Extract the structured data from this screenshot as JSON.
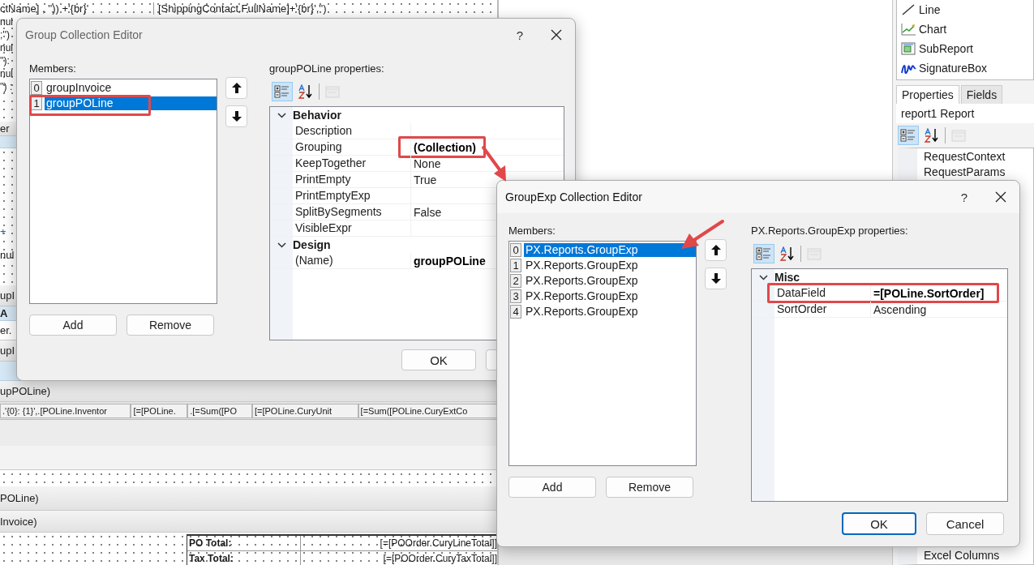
{
  "designer": {
    "top_texts": [
      "ctName] , '')) +'{br}'",
      "[ShippingContact.FullName]+'{br}','')"
    ],
    "left_fragments": [
      "nul",
      ";'')",
      "nul",
      "''):",
      "nul",
      "'') :"
    ],
    "bands": [
      {
        "kind": "label",
        "text": "er"
      },
      {
        "kind": "header"
      },
      {
        "kind": "dotted",
        "fragments": [
          "+",
          "nul"
        ]
      },
      {
        "kind": "label",
        "text": "upI"
      },
      {
        "kind": "header",
        "text": "A"
      },
      {
        "kind": "row",
        "text": "er."
      },
      {
        "kind": "label",
        "text": "upI"
      },
      {
        "kind": "header"
      },
      {
        "kind": "label",
        "text": "upPOLine)"
      },
      {
        "kind": "cells",
        "cells": [
          ".'{0}: {1}',.[POLine.Inventor",
          "[=[POLine.",
          ".[=Sum([PO",
          "[=[POLine.CuryUnit",
          "[=Sum([POLine.CuryExtCo"
        ]
      },
      {
        "kind": "blank"
      },
      {
        "kind": "blank"
      },
      {
        "kind": "dotted"
      },
      {
        "kind": "label",
        "text": "POLine)"
      },
      {
        "kind": "label",
        "text": "Invoice)"
      },
      {
        "kind": "totals",
        "rows": [
          {
            "label": "PO Total:",
            "value": "[=[POOrder.CuryLineTotal]]"
          },
          {
            "label": "Tax Total:",
            "value": "[=[POOrder.CuryTaxTotal]]"
          }
        ]
      }
    ]
  },
  "toolbox": {
    "items": [
      {
        "kind": "line",
        "label": "Line"
      },
      {
        "kind": "chart",
        "label": "Chart"
      },
      {
        "kind": "subreport",
        "label": "SubReport"
      },
      {
        "kind": "signature",
        "label": "SignatureBox"
      }
    ]
  },
  "properties_panel": {
    "tabs": [
      {
        "label": "Properties",
        "selected": true
      },
      {
        "label": "Fields",
        "selected": false
      }
    ],
    "object": "report1 Report",
    "toolbar": [
      {
        "kind": "categorized",
        "selected": true,
        "disabled": false
      },
      {
        "kind": "alphabetical",
        "selected": false,
        "disabled": false
      },
      {
        "kind": "pages",
        "selected": false,
        "disabled": true
      }
    ],
    "rows_top": [
      "RequestContext",
      "RequestParams"
    ],
    "rows_bottom": [
      "Excel Columns"
    ]
  },
  "dialogs": [
    {
      "title": "Group Collection Editor",
      "active": false,
      "help": "?",
      "members_label": "Members:",
      "members": [
        {
          "index": "0",
          "name": "groupInvoice",
          "selected": false,
          "highlighted": false
        },
        {
          "index": "1",
          "name": "groupPOLine",
          "selected": true,
          "highlighted": true
        }
      ],
      "buttons": [
        "Add",
        "Remove"
      ],
      "properties_label": "groupPOLine properties:",
      "toolbar": [
        {
          "kind": "categorized",
          "selected": true,
          "disabled": false
        },
        {
          "kind": "alphabetical",
          "selected": false,
          "disabled": false
        },
        {
          "kind": "pages",
          "selected": false,
          "disabled": true
        }
      ],
      "categories": [
        {
          "name": "Behavior",
          "expanded": true,
          "rows": [
            {
              "name": "Description"
            },
            {
              "name": "Grouping",
              "value": "(Collection)",
              "modified": true,
              "highlighted": true
            },
            {
              "name": "KeepTogether",
              "value": "None",
              "modified": false
            },
            {
              "name": "PrintEmpty",
              "value": "True",
              "modified": false
            },
            {
              "name": "PrintEmptyExp"
            },
            {
              "name": "SplitBySegments",
              "value": "False",
              "modified": false
            },
            {
              "name": "VisibleExpr"
            }
          ]
        },
        {
          "name": "Design",
          "expanded": true,
          "rows": [
            {
              "name": "(Name)",
              "value": "groupPOLine",
              "modified": true
            }
          ]
        }
      ],
      "footer_buttons": [
        {
          "label": "OK",
          "default": false
        },
        {
          "default": false
        }
      ]
    },
    {
      "title": "GroupExp Collection Editor",
      "active": true,
      "help": "?",
      "members_label": "Members:",
      "members": [
        {
          "index": "0",
          "name": "PX.Reports.GroupExp",
          "selected": true,
          "highlighted": false
        },
        {
          "index": "1",
          "name": "PX.Reports.GroupExp",
          "selected": false,
          "highlighted": false
        },
        {
          "index": "2",
          "name": "PX.Reports.GroupExp",
          "selected": false,
          "highlighted": false
        },
        {
          "index": "3",
          "name": "PX.Reports.GroupExp",
          "selected": false,
          "highlighted": false
        },
        {
          "index": "4",
          "name": "PX.Reports.GroupExp",
          "selected": false,
          "highlighted": false
        }
      ],
      "buttons": [
        "Add",
        "Remove"
      ],
      "properties_label": "PX.Reports.GroupExp properties:",
      "toolbar": [
        {
          "kind": "categorized",
          "selected": true,
          "disabled": false
        },
        {
          "kind": "alphabetical",
          "selected": false,
          "disabled": false
        },
        {
          "kind": "pages",
          "selected": false,
          "disabled": true
        }
      ],
      "categories": [
        {
          "name": "Misc",
          "expanded": true,
          "rows": [
            {
              "name": "DataField",
              "value": "=[POLine.SortOrder]",
              "modified": true,
              "highlighted": true
            },
            {
              "name": "SortOrder",
              "value": "Ascending",
              "modified": false
            }
          ]
        }
      ],
      "footer_buttons": [
        {
          "label": "OK",
          "default": true
        },
        {
          "label": "Cancel",
          "default": false
        }
      ]
    }
  ]
}
